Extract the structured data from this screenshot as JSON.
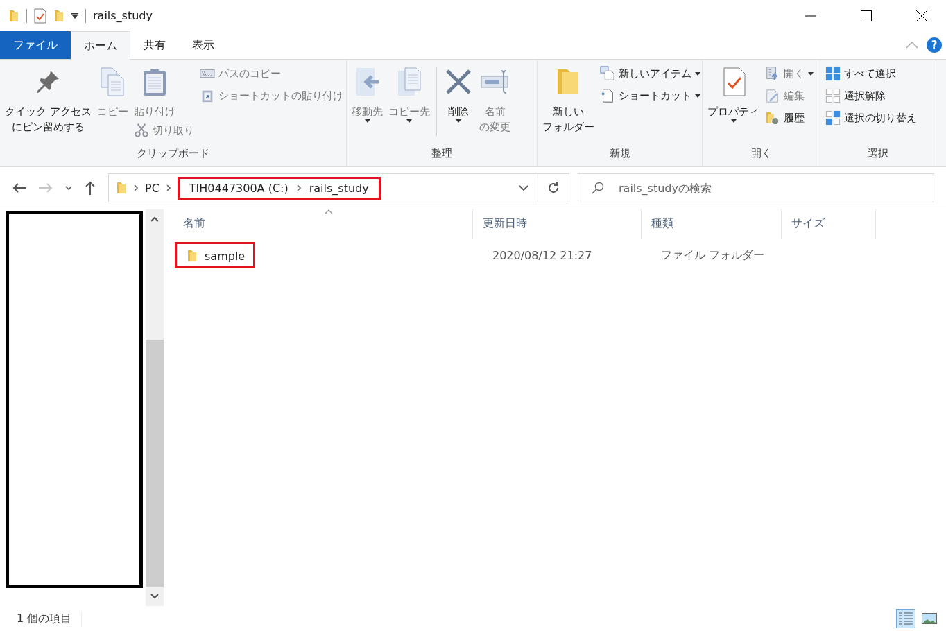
{
  "window": {
    "title": "rails_study"
  },
  "tabs": [
    {
      "label": "ファイル",
      "kind": "file",
      "selected": false
    },
    {
      "label": "ホーム",
      "kind": "tab",
      "selected": true
    },
    {
      "label": "共有",
      "kind": "tab",
      "selected": false
    },
    {
      "label": "表示",
      "kind": "tab",
      "selected": false
    }
  ],
  "help": {
    "label": "?"
  },
  "ribbon": {
    "groups": [
      {
        "label": "クリップボード",
        "columns": [
          {
            "kind": "commands",
            "items": [
              {
                "kind": "large",
                "lines": [
                  "クイック アクセス",
                  "にピン留めする"
                ],
                "disabled": false,
                "dropdown": false
              }
            ]
          },
          {
            "kind": "commands",
            "items": [
              {
                "kind": "large",
                "label": "コピー",
                "disabled": true,
                "dropdown": false
              }
            ]
          },
          {
            "kind": "commands",
            "items": [
              {
                "kind": "large",
                "label": "貼り付け",
                "disabled": true,
                "dropdown": false
              },
              {
                "kind": "small",
                "label": "切り取り",
                "disabled": true,
                "dropdown": false
              }
            ]
          },
          {
            "kind": "commands",
            "items": [
              {
                "kind": "small",
                "label": "パスのコピー",
                "disabled": true,
                "dropdown": false
              },
              {
                "kind": "small",
                "label": "ショートカットの貼り付け",
                "disabled": true,
                "dropdown": false
              }
            ]
          }
        ]
      },
      {
        "label": "整理",
        "columns": [
          {
            "kind": "commands",
            "items": [
              {
                "kind": "large",
                "label": "移動先",
                "disabled": true,
                "dropdown": true
              }
            ]
          },
          {
            "kind": "commands",
            "items": [
              {
                "kind": "large",
                "label": "コピー先",
                "disabled": true,
                "dropdown": true
              }
            ]
          },
          {
            "kind": "separator"
          },
          {
            "kind": "commands",
            "items": [
              {
                "kind": "large",
                "label": "削除",
                "disabled": false,
                "dropdown": true
              }
            ]
          },
          {
            "kind": "commands",
            "items": [
              {
                "kind": "large",
                "lines": [
                  "名前",
                  "の変更"
                ],
                "disabled": true,
                "dropdown": false
              }
            ]
          }
        ]
      },
      {
        "label": "新規",
        "columns": [
          {
            "kind": "commands",
            "items": [
              {
                "kind": "large",
                "lines": [
                  "新しい",
                  "フォルダー"
                ],
                "disabled": false,
                "dropdown": false
              }
            ]
          },
          {
            "kind": "commands",
            "items": [
              {
                "kind": "small",
                "label": "新しいアイテム",
                "disabled": false,
                "dropdown": true
              },
              {
                "kind": "small",
                "label": "ショートカット",
                "disabled": false,
                "dropdown": true
              }
            ]
          }
        ]
      },
      {
        "label": "開く",
        "columns": [
          {
            "kind": "commands",
            "items": [
              {
                "kind": "large",
                "label": "プロパティ",
                "disabled": false,
                "dropdown": true
              }
            ]
          },
          {
            "kind": "commands",
            "items": [
              {
                "kind": "small",
                "label": "開く",
                "disabled": true,
                "dropdown": true
              },
              {
                "kind": "small",
                "label": "編集",
                "disabled": true,
                "dropdown": false
              },
              {
                "kind": "small",
                "label": "履歴",
                "disabled": false,
                "dropdown": false
              }
            ]
          }
        ]
      },
      {
        "label": "選択",
        "columns": [
          {
            "kind": "commands",
            "items": [
              {
                "kind": "small",
                "label": "すべて選択",
                "disabled": false,
                "dropdown": false
              },
              {
                "kind": "small",
                "label": "選択解除",
                "disabled": false,
                "dropdown": false
              },
              {
                "kind": "small",
                "label": "選択の切り替え",
                "disabled": false,
                "dropdown": false
              }
            ]
          }
        ]
      }
    ]
  },
  "nav_buttons": [
    {
      "kind": "back",
      "disabled": false
    },
    {
      "kind": "forward",
      "disabled": true
    },
    {
      "kind": "recent",
      "disabled": false
    },
    {
      "kind": "up",
      "disabled": false
    }
  ],
  "address": {
    "crumbs": [
      {
        "label": "PC",
        "highlighted": false
      },
      {
        "label": "TIH0447300A (C:)",
        "highlighted": true
      },
      {
        "label": "rails_study",
        "highlighted": true
      }
    ]
  },
  "search": {
    "placeholder": "rails_studyの検索"
  },
  "file_list": {
    "columns": [
      "名前",
      "更新日時",
      "種類",
      "サイズ"
    ],
    "rows": [
      {
        "name": "sample",
        "modified": "2020/08/12 21:27",
        "type": "ファイル フォルダー",
        "highlighted": true
      }
    ]
  },
  "status_bar": {
    "item_count": "1 個の項目",
    "views": [
      {
        "kind": "details",
        "selected": true
      },
      {
        "kind": "large-icons",
        "selected": false
      }
    ]
  }
}
